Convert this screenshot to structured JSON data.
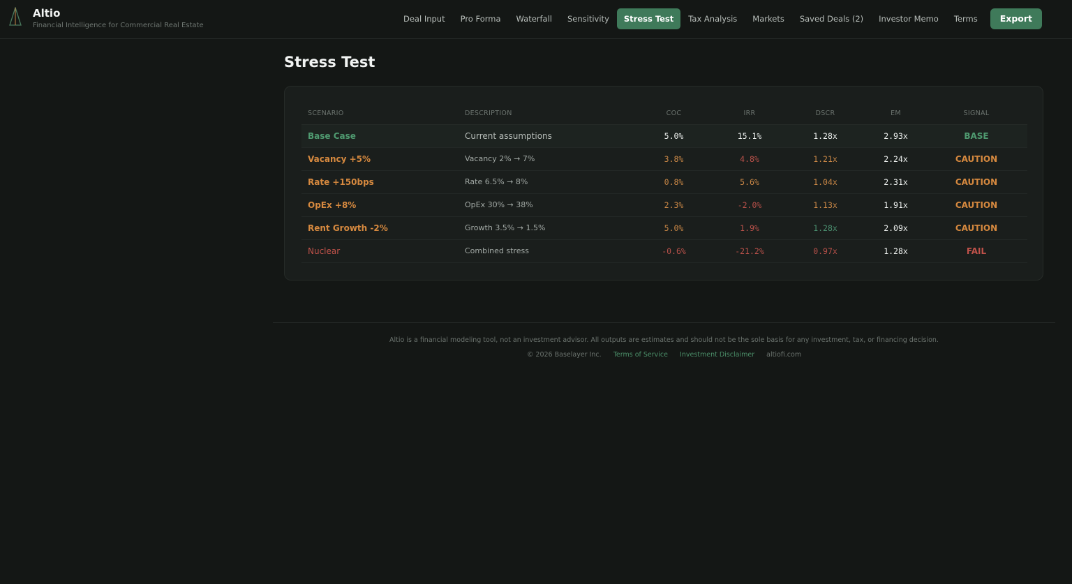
{
  "brand": {
    "name": "Altio",
    "tagline": "Financial Intelligence for Commercial Real Estate"
  },
  "nav": {
    "items": [
      {
        "label": "Deal Input",
        "active": false
      },
      {
        "label": "Pro Forma",
        "active": false
      },
      {
        "label": "Waterfall",
        "active": false
      },
      {
        "label": "Sensitivity",
        "active": false
      },
      {
        "label": "Stress Test",
        "active": true
      },
      {
        "label": "Tax Analysis",
        "active": false
      },
      {
        "label": "Markets",
        "active": false
      },
      {
        "label": "Saved Deals (2)",
        "active": false
      },
      {
        "label": "Investor Memo",
        "active": false
      },
      {
        "label": "Terms",
        "active": false
      }
    ],
    "export_label": "Export"
  },
  "page": {
    "title": "Stress Test"
  },
  "table": {
    "headers": [
      "SCENARIO",
      "DESCRIPTION",
      "COC",
      "IRR",
      "DSCR",
      "EM",
      "SIGNAL"
    ],
    "rows": [
      {
        "scenario": "Base Case",
        "description": "Current assumptions",
        "coc": "5.0%",
        "irr": "15.1%",
        "dscr": "1.28x",
        "em": "2.93x",
        "signal": "BASE"
      },
      {
        "scenario": "Vacancy +5%",
        "description": "Vacancy 2% → 7%",
        "coc": "3.8%",
        "irr": "4.8%",
        "dscr": "1.21x",
        "em": "2.24x",
        "signal": "CAUTION"
      },
      {
        "scenario": "Rate +150bps",
        "description": "Rate 6.5% → 8%",
        "coc": "0.8%",
        "irr": "5.6%",
        "dscr": "1.04x",
        "em": "2.31x",
        "signal": "CAUTION"
      },
      {
        "scenario": "OpEx +8%",
        "description": "OpEx 30% → 38%",
        "coc": "2.3%",
        "irr": "-2.0%",
        "dscr": "1.13x",
        "em": "1.91x",
        "signal": "CAUTION"
      },
      {
        "scenario": "Rent Growth -2%",
        "description": "Growth 3.5% → 1.5%",
        "coc": "5.0%",
        "irr": "1.9%",
        "dscr": "1.28x",
        "em": "2.09x",
        "signal": "CAUTION"
      },
      {
        "scenario": "Nuclear",
        "description": "Combined stress",
        "coc": "-0.6%",
        "irr": "-21.2%",
        "dscr": "0.97x",
        "em": "1.28x",
        "signal": "FAIL"
      }
    ]
  },
  "footer": {
    "disclaimer": "Altio is a financial modeling tool, not an investment advisor. All outputs are estimates and should not be the sole basis for any investment, tax, or financing decision.",
    "copyright": "© 2026 Baselayer Inc.",
    "terms_link": "Terms of Service",
    "disclaimer_link": "Investment Disclaimer",
    "site": "altiofi.com"
  },
  "colors": {
    "background": "#141715",
    "accent": "#3f7a5a",
    "base": "#4f9a70",
    "caution": "#d6893f",
    "fail": "#c0524a"
  },
  "icons": {
    "logo": "triangle-logo-icon"
  }
}
